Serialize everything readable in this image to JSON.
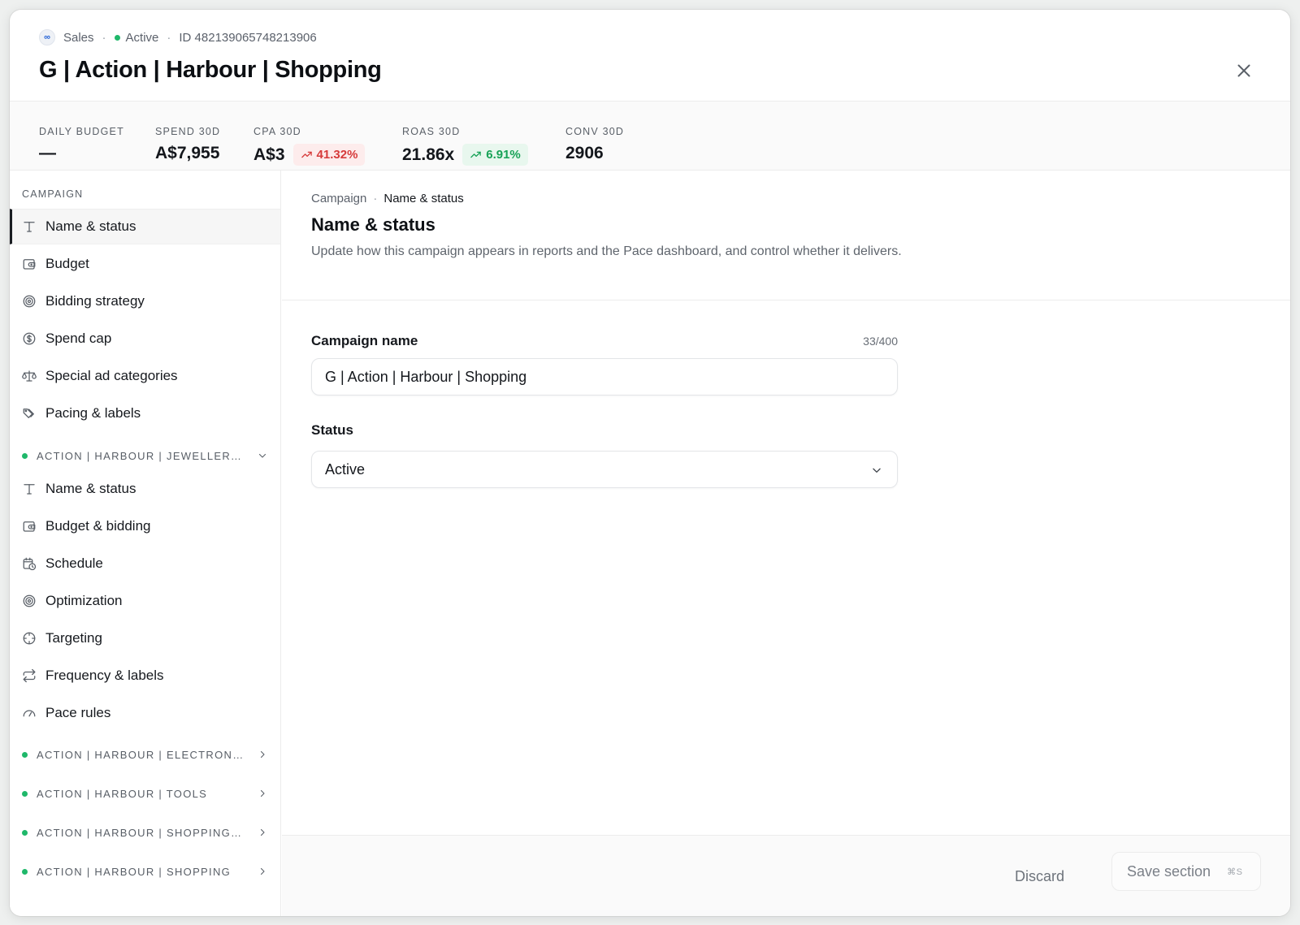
{
  "header": {
    "logo_glyph": "∞",
    "platform": "Sales",
    "status": "Active",
    "campaign_id": "ID 482139065748213906",
    "title": "G | Action | Harbour | Shopping"
  },
  "stats": [
    {
      "label": "DAILY BUDGET",
      "value": "—"
    },
    {
      "label": "SPEND 30D",
      "value": "A$7,955"
    },
    {
      "label": "CPA 30D",
      "value": "A$3",
      "delta": "41.32%",
      "delta_color": "#d63b3b"
    },
    {
      "label": "ROAS 30D",
      "value": "21.86x",
      "delta": "6.91%",
      "delta_color": "#18a257"
    },
    {
      "label": "CONV 30D",
      "value": "2906"
    }
  ],
  "sidebar": {
    "campaign_heading": "CAMPAIGN",
    "campaign_items": [
      {
        "label": "Name & status",
        "icon": "text-icon"
      },
      {
        "label": "Budget",
        "icon": "wallet-icon"
      },
      {
        "label": "Bidding strategy",
        "icon": "target-icon"
      },
      {
        "label": "Spend cap",
        "icon": "dollar-circle-icon"
      },
      {
        "label": "Special ad categories",
        "icon": "scale-icon"
      },
      {
        "label": "Pacing & labels",
        "icon": "tags-icon"
      }
    ],
    "expanded_group": {
      "label": "ACTION | HARBOUR | JEWELLERY A...",
      "items": [
        {
          "label": "Name & status",
          "icon": "text-icon"
        },
        {
          "label": "Budget & bidding",
          "icon": "wallet-icon"
        },
        {
          "label": "Schedule",
          "icon": "calendar-clock-icon"
        },
        {
          "label": "Optimization",
          "icon": "target-icon"
        },
        {
          "label": "Targeting",
          "icon": "crosshair-icon"
        },
        {
          "label": "Frequency & labels",
          "icon": "repeat-icon"
        },
        {
          "label": "Pace rules",
          "icon": "gauge-icon"
        }
      ]
    },
    "collapsed_groups": [
      {
        "label": "ACTION | HARBOUR | ELECTRONICS"
      },
      {
        "label": "ACTION | HARBOUR | TOOLS"
      },
      {
        "label": "ACTION | HARBOUR | SHOPPING | P..."
      },
      {
        "label": "ACTION | HARBOUR | SHOPPING"
      }
    ]
  },
  "main": {
    "breadcrumb_parent": "Campaign",
    "breadcrumb_current": "Name & status",
    "title": "Name & status",
    "description": "Update how this campaign appears in reports and the Pace dashboard, and control whether it delivers.",
    "campaign_name_label": "Campaign name",
    "campaign_name_counter": "33/400",
    "campaign_name_value": "G | Action | Harbour | Shopping",
    "status_label": "Status",
    "status_value": "Active"
  },
  "footer": {
    "discard_label": "Discard",
    "save_label": "Save section",
    "save_shortcut": "⌘S"
  },
  "colors": {
    "active_dot": "#1fb86a",
    "delta_negative_bg": "#fdecec",
    "delta_positive_bg": "#e8f7ee"
  }
}
